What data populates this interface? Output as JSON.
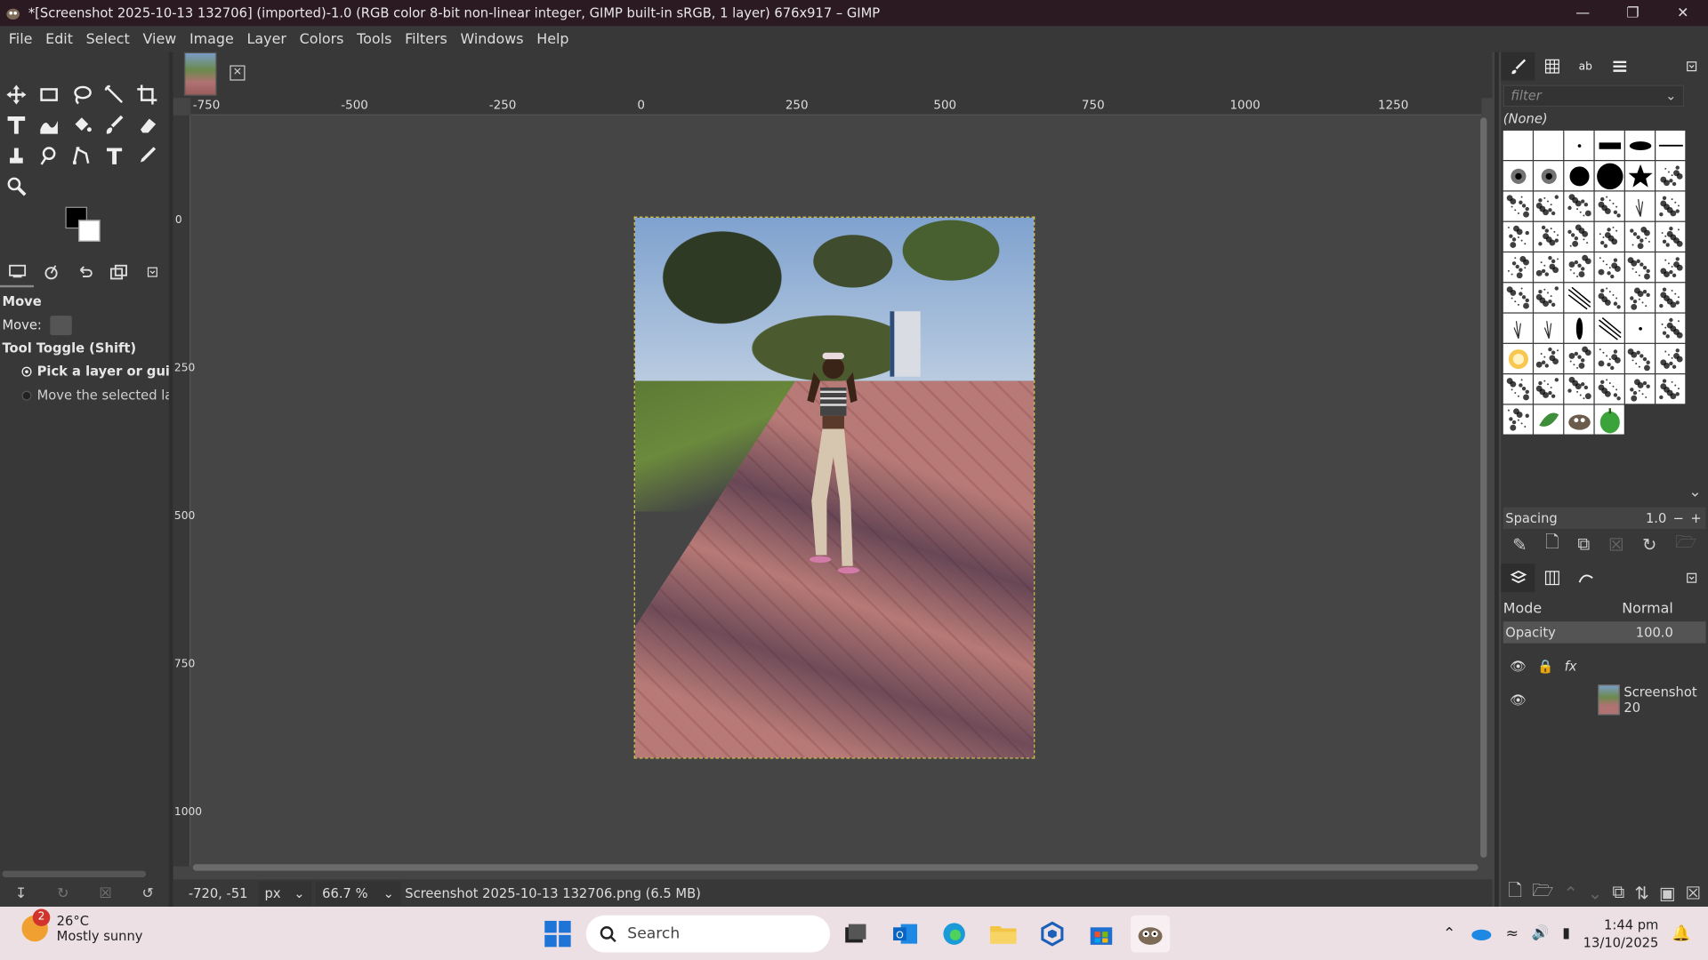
{
  "window": {
    "title": "*[Screenshot 2025-10-13 132706] (imported)-1.0 (RGB color 8-bit non-linear integer, GIMP built-in sRGB, 1 layer) 676x917 – GIMP"
  },
  "menu": [
    "File",
    "Edit",
    "Select",
    "View",
    "Image",
    "Layer",
    "Colors",
    "Tools",
    "Filters",
    "Windows",
    "Help"
  ],
  "ruler": {
    "h_labels": [
      "-750",
      "-500",
      "-250",
      "0",
      "250",
      "500",
      "750",
      "1000",
      "1250"
    ],
    "v_labels": [
      "0",
      "250",
      "500",
      "750",
      "1000"
    ]
  },
  "tool_options": {
    "tool_name": "Move",
    "move_label": "Move:",
    "toggle_label": "Tool Toggle  (Shift)",
    "option_pick": "Pick a layer or guide",
    "option_move": "Move the selected lay"
  },
  "status": {
    "coords": "-720, -51",
    "unit": "px",
    "zoom": "66.7 %",
    "file": "Screenshot 2025-10-13 132706.png (6.5 MB)"
  },
  "brushes": {
    "filter_placeholder": "filter",
    "selected": "(None)",
    "spacing_label": "Spacing",
    "spacing_value": "1.0"
  },
  "layers": {
    "mode_label": "Mode",
    "mode_value": "Normal",
    "opacity_label": "Opacity",
    "opacity_value": "100.0",
    "layer_name": "Screenshot 20"
  },
  "taskbar": {
    "temperature": "26°C",
    "weather": "Mostly sunny",
    "weather_badge": "2",
    "search_placeholder": "Search",
    "time": "1:44 pm",
    "date": "13/10/2025"
  }
}
